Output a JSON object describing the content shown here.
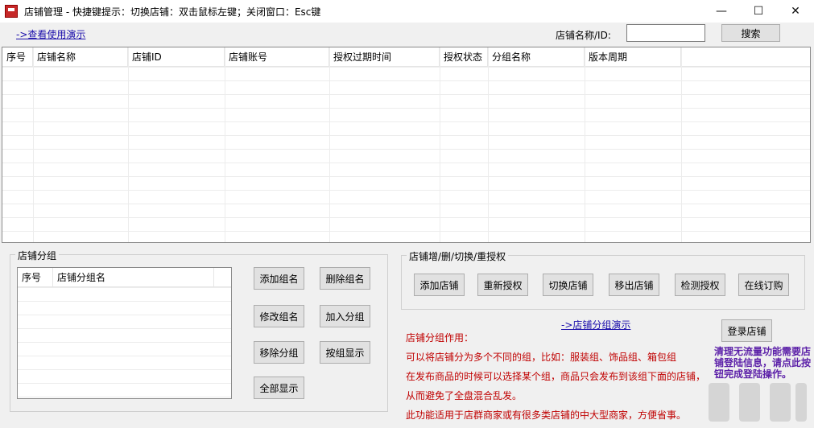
{
  "window": {
    "title": "店铺管理 - 快捷键提示：切换店铺：双击鼠标左键；关闭窗口：Esc键",
    "minimize": "—",
    "maximize": "☐",
    "close": "✕"
  },
  "top": {
    "demo_link": "->查看使用演示",
    "search_label": "店铺名称/ID:",
    "search_value": "",
    "search_button": "搜索"
  },
  "main_grid": {
    "columns": [
      "序号",
      "店铺名称",
      "店铺ID",
      "店铺账号",
      "授权过期时间",
      "授权状态",
      "分组名称",
      "版本周期"
    ]
  },
  "shop_group": {
    "title": "店铺分组",
    "columns": [
      "序号",
      "店铺分组名"
    ],
    "buttons": {
      "add_group": "添加组名",
      "delete_group": "删除组名",
      "rename_group": "修改组名",
      "join_group": "加入分组",
      "remove_group": "移除分组",
      "show_by_group": "按组显示",
      "show_all": "全部显示"
    }
  },
  "ops_group": {
    "title": "店铺增/删/切换/重授权",
    "buttons": {
      "add_shop": "添加店铺",
      "reauthorize": "重新授权",
      "switch_shop": "切换店铺",
      "remove_shop": "移出店铺",
      "check_auth": "检测授权",
      "online_order": "在线订购"
    }
  },
  "group_demo_link": "->店铺分组演示",
  "login_button": "登录店铺",
  "info": {
    "line1": "店铺分组作用：",
    "line2": "可以将店铺分为多个不同的组，比如：服装组、饰品组、箱包组",
    "line3": "在发布商品的时候可以选择某个组，商品只会发布到该组下面的店铺，",
    "line4": "从而避免了全盘混合乱发。",
    "line5": "此功能适用于店群商家或有很多类店铺的中大型商家，方便省事。"
  },
  "notice": "清理无流量功能需要店铺登陆信息，请点此按钮完成登陆操作。",
  "colors": {
    "info_red": "#c00000",
    "notice_purple": "#5b1fa8",
    "link_blue": "#1a0dab"
  }
}
